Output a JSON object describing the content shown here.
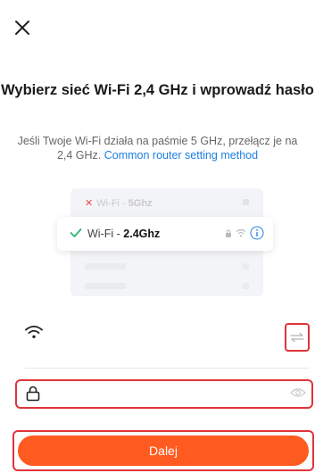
{
  "header": {
    "close_icon": "close-icon"
  },
  "title": "Wybierz sieć Wi-Fi 2,4 GHz i wprowadź hasło",
  "subtitle": {
    "text": "Jeśli Twoje Wi-Fi działa na paśmie 5 GHz, przełącz je na 2,4 GHz.",
    "link": "Common router setting method"
  },
  "illustration": {
    "bad_network": {
      "prefix": "Wi-Fi - ",
      "band": "5Ghz",
      "mark": "✕"
    },
    "good_network": {
      "prefix": "Wi-Fi - ",
      "band": "2.4Ghz"
    }
  },
  "form": {
    "wifi_name_value": "",
    "password_value": ""
  },
  "buttons": {
    "next": "Dalej"
  },
  "colors": {
    "accent": "#ff5a1f",
    "link": "#1e7fe0",
    "highlight": "#e0343a",
    "check": "#2bb673"
  }
}
